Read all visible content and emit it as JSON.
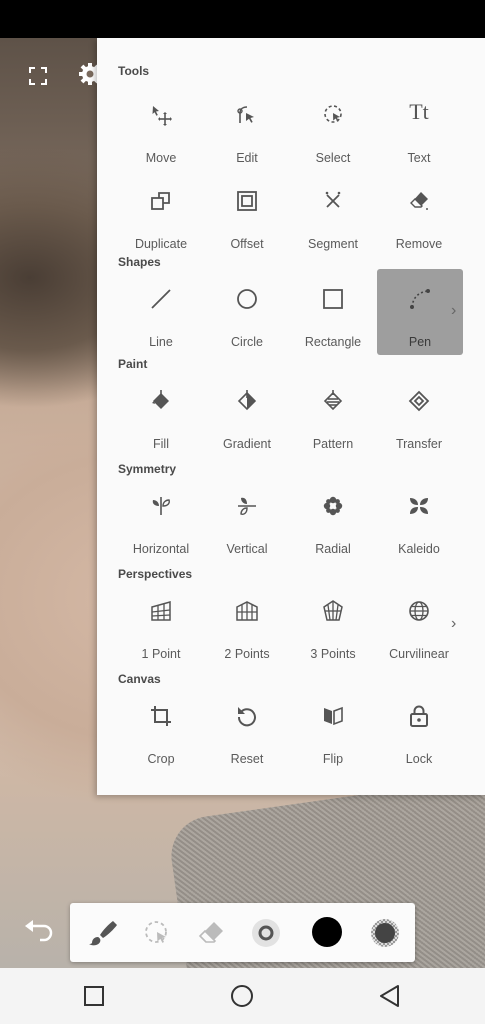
{
  "panel": {
    "sections": {
      "tools": "Tools",
      "shapes": "Shapes",
      "paint": "Paint",
      "symmetry": "Symmetry",
      "perspectives": "Perspectives",
      "canvas": "Canvas"
    },
    "tools": {
      "move": "Move",
      "edit": "Edit",
      "select": "Select",
      "text": "Text",
      "duplicate": "Duplicate",
      "offset": "Offset",
      "segment": "Segment",
      "remove": "Remove"
    },
    "shapes": {
      "line": "Line",
      "circle": "Circle",
      "rectangle": "Rectangle",
      "pen": "Pen"
    },
    "paint": {
      "fill": "Fill",
      "gradient": "Gradient",
      "pattern": "Pattern",
      "transfer": "Transfer"
    },
    "symmetry": {
      "horizontal": "Horizontal",
      "vertical": "Vertical",
      "radial": "Radial",
      "kaleido": "Kaleido"
    },
    "perspectives": {
      "one_point": "1 Point",
      "two_points": "2 Points",
      "three_points": "3 Points",
      "curvilinear": "Curvilinear"
    },
    "canvas": {
      "crop": "Crop",
      "reset": "Reset",
      "flip": "Flip",
      "lock": "Lock"
    },
    "text_icon_glyph": "Tt",
    "more_glyph": "›"
  },
  "colors": {
    "panel_bg": "#fafafa",
    "active_tool_bg": "#9e9e9e",
    "icon": "#555555",
    "current_color": "#000000"
  },
  "icons": {
    "top_left": [
      "expand-icon",
      "settings-icon"
    ],
    "bottom_toolbar": [
      "brush-icon",
      "lasso-select-icon",
      "eraser-icon",
      "brush-size-icon",
      "color-swatch-icon",
      "opacity-icon"
    ],
    "nav": [
      "recents-square-icon",
      "home-circle-icon",
      "back-triangle-icon"
    ]
  }
}
